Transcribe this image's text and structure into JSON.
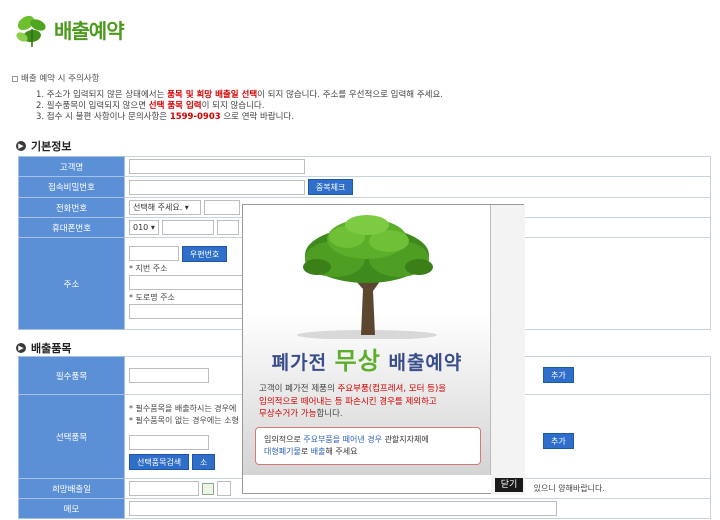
{
  "header": {
    "title": "배출예약"
  },
  "notice": {
    "title": "배출 예약 시 주의사항",
    "items": [
      {
        "pre": "1. 주소가 입력되지 않은 상태에서는 ",
        "hl": "품목 및 희망 배출일 선택",
        "post": "이 되지 않습니다. 주소를 우선적으로 입력해 주세요."
      },
      {
        "pre": "2. 필수품목이 입력되지 않으면 ",
        "hl": "선택 품목 입력",
        "post": "이 되지 않습니다."
      },
      {
        "pre": "3. 접수 시 불편 사항이나 문의사항은 ",
        "hl": "1599-0903",
        "post": " 으로 연락 바랍니다."
      }
    ]
  },
  "sections": {
    "basic": "기본정보",
    "items": "배출품목"
  },
  "labels": {
    "name": "고객명",
    "password": "접속비밀번호",
    "phone": "전화번호",
    "mobile": "휴대폰번호",
    "address": "주소",
    "required": "필수품목",
    "optional": "선택품목",
    "date": "희망배출일",
    "memo": "메모"
  },
  "buttons": {
    "dup_check": "중복체크",
    "zipcode": "우편번호",
    "add_required": "추가",
    "add_optional": "추가",
    "item_search": "선택품목검색",
    "item_search_2": "소"
  },
  "fields": {
    "phone_select": "선택해 주세요.",
    "mobile_prefix": "010",
    "jibun_label": "* 지번 주소",
    "road_label": "* 도로명 주소",
    "opt_note_1": "* 필수품목을 배출하시는 경우에",
    "opt_note_2": "* 필수품목이 없는 경우에는 소형",
    "date_note": "있으니 양해바랍니다."
  },
  "popup": {
    "title_pre": "폐가전 ",
    "title_hl": "무상",
    "title_post": " 배출예약",
    "desc_1": "고객이 폐가전 제품의 ",
    "desc_1_hl": "주요부품(컴프레셔, 모터 등)을",
    "desc_2_hl": "임의적으로 떼어내는 등 파손시킨 경우를 제외하고",
    "desc_3_hl": "무상수거가 가능",
    "desc_3_post": "합니다.",
    "box_1_pre": "임의적으로 ",
    "box_1_hl": "주요부품을 떼어낸 경우",
    "box_1_post": " 관할지자체에",
    "box_2_hl": "대형폐기물",
    "box_2_mid": "로 ",
    "box_2_hl2": "배출",
    "box_2_post": "해 주세요",
    "close": "닫기"
  },
  "colors": {
    "label_bg": "#5b8fd6",
    "button_bg": "#2f6fc9",
    "title_green": "#4b9a1e",
    "highlight_red": "#d60000"
  }
}
